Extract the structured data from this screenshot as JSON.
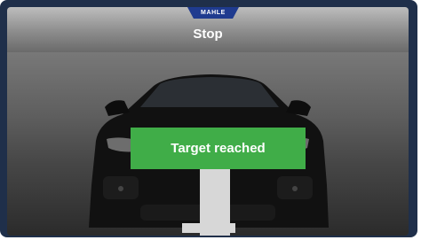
{
  "brand": {
    "name": "MAHLE"
  },
  "header": {
    "title": "Stop"
  },
  "status": {
    "message": "Target reached"
  },
  "colors": {
    "accent_green": "#40ad48",
    "brand_blue": "#1f3b8f",
    "sensor_blue": "#2a6fbb"
  },
  "icons": {
    "sensor": "car-front-icon"
  }
}
